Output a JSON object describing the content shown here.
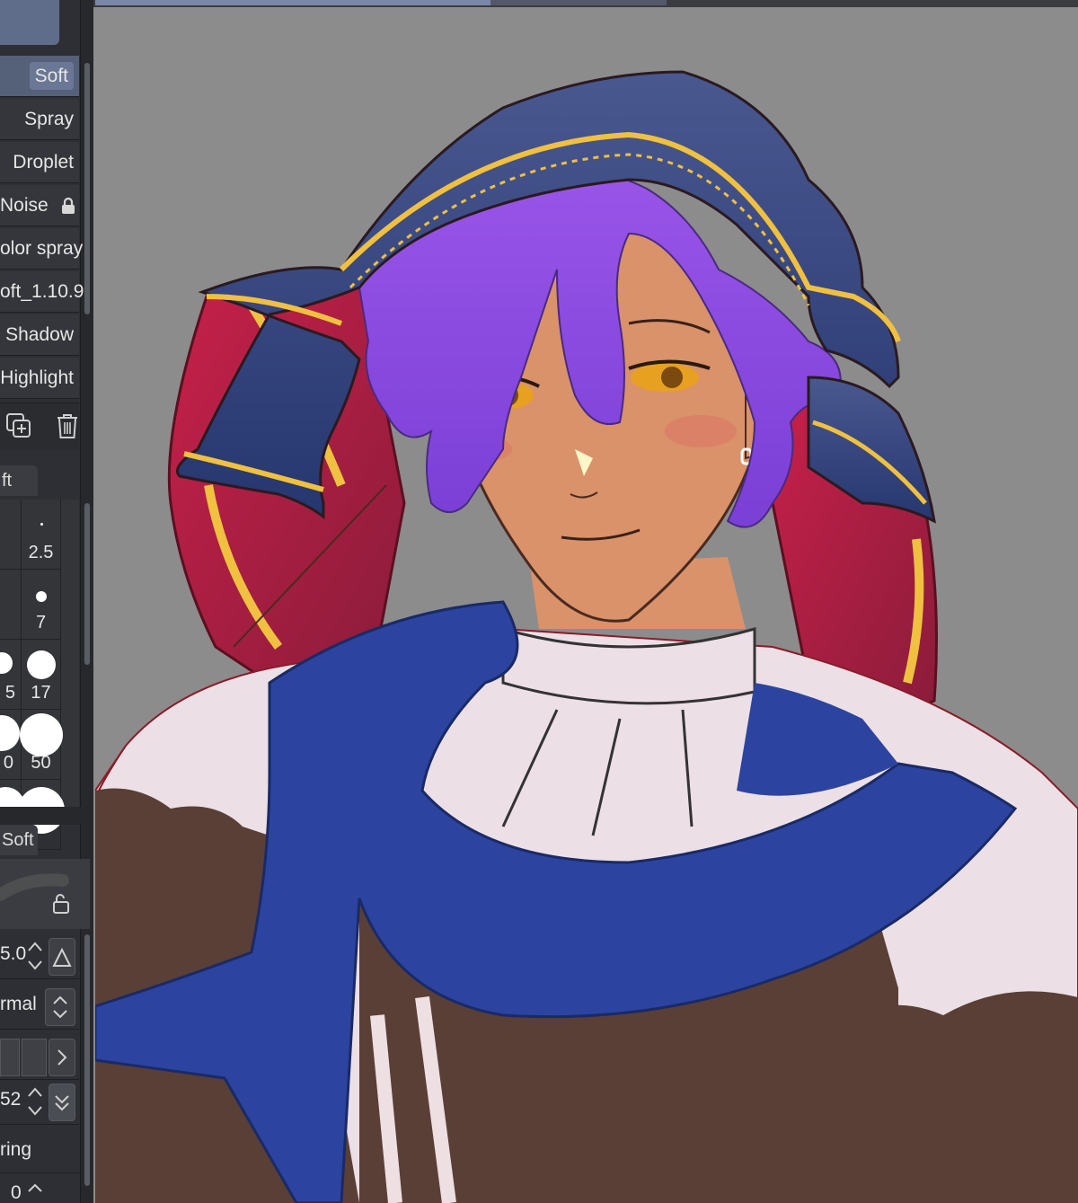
{
  "sub_tools": [
    {
      "label": "Soft",
      "selected": true,
      "locked": false
    },
    {
      "label": "Spray",
      "selected": false,
      "locked": false
    },
    {
      "label": "Droplet",
      "selected": false,
      "locked": false
    },
    {
      "label": "Noise",
      "selected": false,
      "locked": true
    },
    {
      "label": "olor spray",
      "selected": false,
      "locked": false
    },
    {
      "label": "oft_1.10.9",
      "selected": false,
      "locked": false
    },
    {
      "label": "Shadow",
      "selected": false,
      "locked": false
    },
    {
      "label": "Highlight",
      "selected": false,
      "locked": false
    }
  ],
  "brush_size_tab": "ft",
  "brush_sizes": [
    {
      "left": "",
      "right": "2.5"
    },
    {
      "left": "",
      "right": "7"
    },
    {
      "left": "5",
      "right": "17"
    },
    {
      "left": "0",
      "right": "50"
    }
  ],
  "tool_property_tab": "Soft",
  "properties": {
    "size_value": "5.0",
    "blend_mode": "rmal",
    "opacity_value": "52",
    "section_label": "ring",
    "bottom_value": "0"
  },
  "colors": {
    "canvas_bg": "#8c8c8c",
    "panel_bg": "#2d2f34",
    "selected_tool": "#556079"
  }
}
